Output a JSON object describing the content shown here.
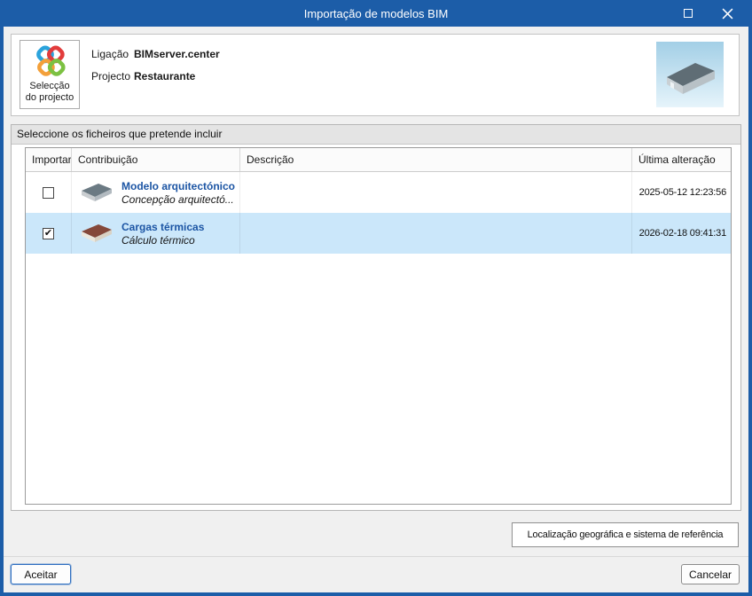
{
  "window": {
    "title": "Importação de modelos BIM"
  },
  "header": {
    "project_button": {
      "line1": "Selecção",
      "line2": "do projecto"
    },
    "fields": [
      {
        "label": "Ligação",
        "value": "BIMserver.center"
      },
      {
        "label": "Projecto",
        "value": "Restaurante"
      }
    ]
  },
  "section": {
    "title": "Seleccione os ficheiros que pretende incluir"
  },
  "table": {
    "columns": [
      "Importar",
      "Contribuição",
      "Descrição",
      "Última alteração"
    ],
    "rows": [
      {
        "checked": false,
        "check_glyph": "",
        "name": "Modelo arquitectónico",
        "subtitle": "Concepção arquitectó...",
        "description": "",
        "last_modified": "2025-05-12 12:23:56"
      },
      {
        "checked": true,
        "check_glyph": "✔",
        "name": "Cargas térmicas",
        "subtitle": "Cálculo térmico",
        "description": "",
        "last_modified": "2026-02-18 09:41:31"
      }
    ]
  },
  "buttons": {
    "location": "Localização geográfica e sistema de referência",
    "accept": "Aceitar",
    "cancel": "Cancelar"
  },
  "colors": {
    "titlebar_blue": "#1c5da8",
    "selected_row": "#cbe7fa",
    "item_title_blue": "#1c55a4"
  }
}
